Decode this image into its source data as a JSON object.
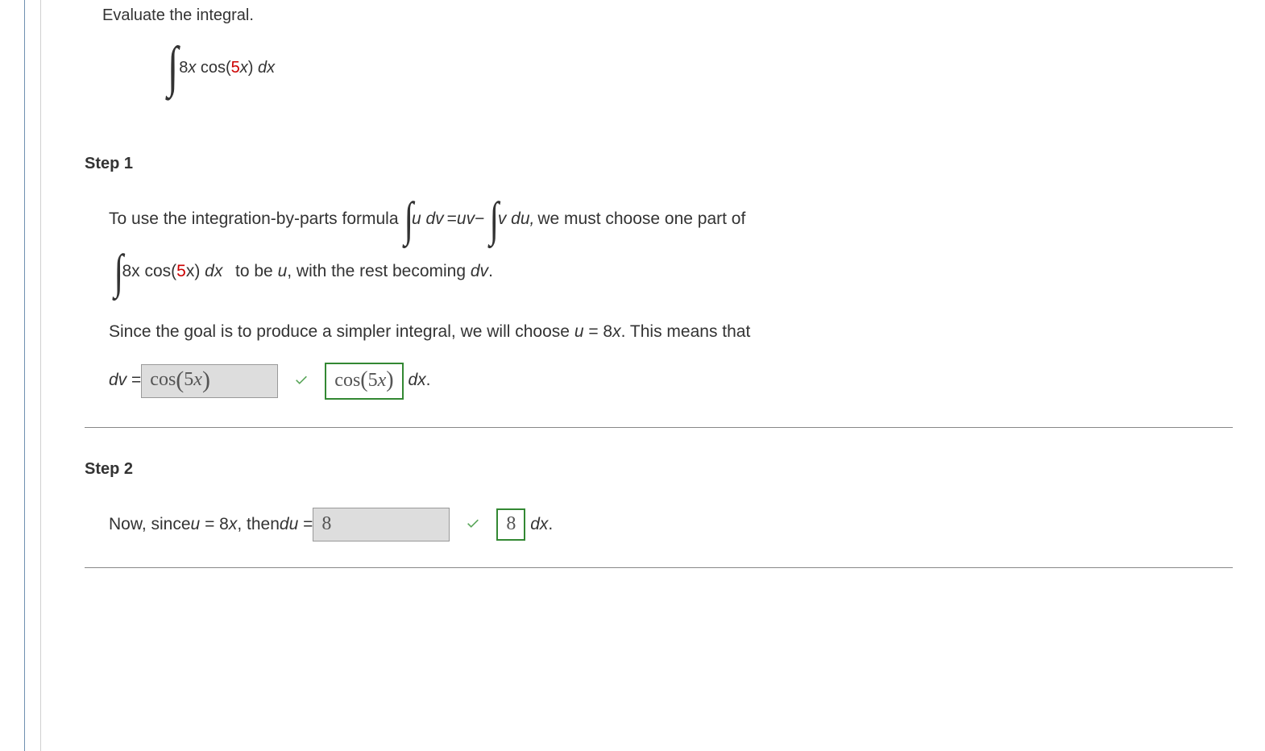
{
  "prompt": "Evaluate the integral.",
  "main_integral": {
    "coeff_text": "8",
    "var": "x",
    "func": "cos(",
    "arg_red": "5",
    "arg_rest": "x",
    "close": ")",
    "dx": " dx"
  },
  "steps": {
    "s1": {
      "heading": "Step 1",
      "line1_a": "To use the integration-by-parts formula ",
      "ibp_left": "u dv",
      "ibp_mid_eq": " = ",
      "ibp_uv": "uv",
      "ibp_minus": " − ",
      "ibp_right": "v du,",
      "line1_b": "  we must choose one part of",
      "line2_prefix": "",
      "line2_integrand_coeff": "8",
      "line2_integrand_rest": "x cos(",
      "line2_red": "5",
      "line2_after": "x) dx",
      "line2_tail": "  to be u, with the rest becoming dv.",
      "para2_a": "Since the goal is to produce a simpler integral, we will choose  ",
      "para2_u_eq": "u = 8x",
      "para2_b": ".  This means that",
      "dv_label": "dv = ",
      "answer_input": "cos(5x)",
      "answer_confirm": "cos (5x)",
      "dx_tail": " dx."
    },
    "s2": {
      "heading": "Step 2",
      "line_a": "Now, since  ",
      "u_eq": "u = 8x",
      "line_b": ",  then  ",
      "du_label": "du = ",
      "answer_input": "8",
      "answer_confirm": "8",
      "dx_tail": " dx."
    }
  }
}
